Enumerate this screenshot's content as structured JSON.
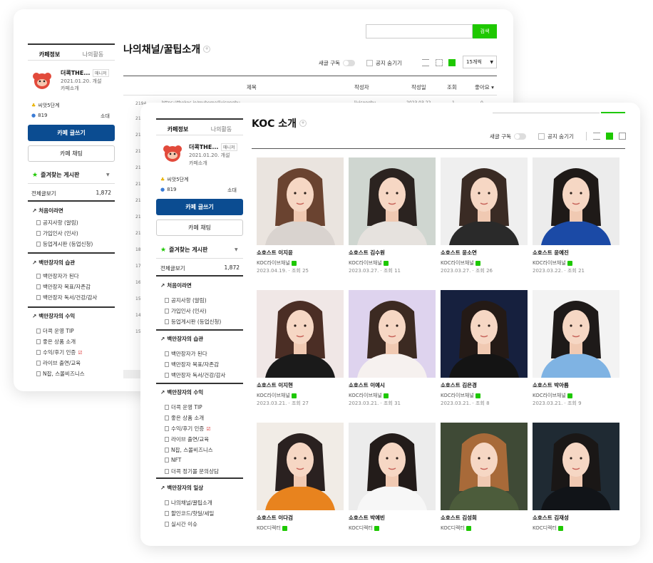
{
  "colors": {
    "accent_green": "#1ec800",
    "button_navy": "#0b4c91"
  },
  "back": {
    "search": {
      "value": "",
      "button": "검색"
    },
    "sidebar": {
      "tabs": [
        "카페정보",
        "나의활동"
      ],
      "profile": {
        "name": "더콕THE...",
        "role": "매니저",
        "date": "2021.01.20. 개설",
        "nickname": "카페소개"
      },
      "level": "씨앗5단계",
      "members": "819",
      "town": "소대",
      "write_button": "카페 글쓰기",
      "chat_button": "카페 채팅",
      "favorites_label": "즐겨찾는 게시판",
      "all_posts": {
        "label": "전체글보기",
        "count": "1,872"
      },
      "groups": [
        {
          "title": "처음이라면",
          "items": [
            "공지사항 (알림)",
            "가입인사 (인사)",
            "등업게시판 (등업신청)"
          ]
        },
        {
          "title": "백만장자의 습관",
          "items": [
            "백만장자가 된다",
            "백만장자 목표/자존감",
            "백만장자 독서/건강/감사"
          ]
        },
        {
          "title": "백만장자의 수익",
          "items": [
            "더콕 운영 TIP",
            "좋은 상품 소개",
            "수익/후기 인증",
            "라이브 출연/교육",
            "N잡, 스몰비즈니스"
          ]
        }
      ]
    },
    "board": {
      "title": "나의채널/꿀팁소개",
      "subscribe": "새글 구독",
      "hide_notice": "공지 숨기기",
      "per_page": "15개씩",
      "headers": {
        "title": "제목",
        "author": "작성자",
        "date": "작성일",
        "views": "조회",
        "likes": "좋아요"
      },
      "first_row": {
        "no": "2194",
        "title": "https://thekoc.io/myhome/livisonghu",
        "author": "livisonghu",
        "date": "2023.03.22.",
        "views": "1",
        "likes": "0"
      },
      "row_numbers": [
        "21",
        "21",
        "21",
        "21",
        "21",
        "21",
        "21",
        "21",
        "18",
        "17",
        "16",
        "15",
        "14",
        "15"
      ]
    }
  },
  "front": {
    "sidebar": {
      "tabs": [
        "카페정보",
        "나의활동"
      ],
      "profile": {
        "name": "더콕THE...",
        "role": "매니저",
        "date": "2021.01.20. 개설",
        "nickname": "카페소개"
      },
      "level": "씨앗5단계",
      "members": "819",
      "town": "소대",
      "write_button": "카페 글쓰기",
      "chat_button": "카페 채팅",
      "favorites_label": "즐겨찾는 게시판",
      "all_posts": {
        "label": "전체글보기",
        "count": "1,872"
      },
      "groups": [
        {
          "title": "처음이라면",
          "items": [
            "공지사항 (알림)",
            "가입인사 (인사)",
            "등업게시판 (등업신청)"
          ]
        },
        {
          "title": "백만장자의 습관",
          "items": [
            "백만장자가 된다",
            "백만장자 목표/자존감",
            "백만장자 독서/건강/감사"
          ]
        },
        {
          "title": "백만장자의 수익",
          "items": [
            "더콕 운영 TIP",
            "좋은 상품 소개",
            "수익/후기 인증",
            "라이브 출연/교육",
            "N잡, 스몰비즈니스",
            "NFT",
            "더콕 정기몰 문의상담"
          ]
        },
        {
          "title": "백만장자의 일상",
          "items": [
            "나의채널/꿀팁소개",
            "할인코드/핫딜/세일",
            "실시간 이슈"
          ]
        }
      ]
    },
    "board": {
      "title": "KOC 소개",
      "subscribe": "새글 구독",
      "hide_notice": "공지 숨기기"
    },
    "cards": [
      {
        "title": "쇼호스트 이지윤",
        "author": "KOC라이브채널",
        "date": "2023.04.19.",
        "views": "· 조회 25"
      },
      {
        "title": "쇼호스트 김수원",
        "author": "KOC라이브채널",
        "date": "2023.03.27.",
        "views": "· 조회 11"
      },
      {
        "title": "쇼호스트 윤소연",
        "author": "KOC라이브채널",
        "date": "2023.03.27.",
        "views": "· 조회 26"
      },
      {
        "title": "쇼호스트 윤예진",
        "author": "KOC라이브채널",
        "date": "2023.03.22.",
        "views": "· 조회 21"
      },
      {
        "title": "쇼호스트 이지현",
        "author": "KOC라이브채널",
        "date": "2023.03.21.",
        "views": "· 조회 27"
      },
      {
        "title": "쇼호스트 이예시",
        "author": "KOC라이브채널",
        "date": "2023.03.21.",
        "views": "· 조회 31"
      },
      {
        "title": "쇼호스트 김은경",
        "author": "KOC라이브채널",
        "date": "2023.03.21.",
        "views": "· 조회 8"
      },
      {
        "title": "쇼호스트 박아름",
        "author": "KOC라이브채널",
        "date": "2023.03.21.",
        "views": "· 조회 9"
      },
      {
        "title": "쇼호스트 이다검",
        "author": "KOC디렉터",
        "date": "",
        "views": ""
      },
      {
        "title": "쇼호스트 박예빈",
        "author": "KOC디렉터",
        "date": "",
        "views": ""
      },
      {
        "title": "쇼호스트 김성희",
        "author": "KOC디렉터",
        "date": "",
        "views": ""
      },
      {
        "title": "쇼호스트 김재성",
        "author": "KOC디렉터",
        "date": "",
        "views": ""
      }
    ],
    "thumb_colors": [
      {
        "bg": "#eae4df",
        "hair": "#6a4330",
        "top": "#d9d3cf"
      },
      {
        "bg": "#cfd6d0",
        "hair": "#2b2320",
        "top": "#e6e2de"
      },
      {
        "bg": "#efefef",
        "hair": "#3a2b24",
        "top": "#2a2a2a"
      },
      {
        "bg": "#ececec",
        "hair": "#1f1a18",
        "top": "#1b4aa6"
      },
      {
        "bg": "#f0e7e6",
        "hair": "#4b2e25",
        "top": "#1a1a1a"
      },
      {
        "bg": "#ded3ee",
        "hair": "#3c2a22",
        "top": "#f6f1ef"
      },
      {
        "bg": "#16203e",
        "hair": "#241a16",
        "top": "#141414"
      },
      {
        "bg": "#f3f3f3",
        "hair": "#1e1a19",
        "top": "#7fb3e3"
      },
      {
        "bg": "#f1ece6",
        "hair": "#2a2120",
        "top": "#e8831e"
      },
      {
        "bg": "#ececec",
        "hair": "#231c1a",
        "top": "#f7f7f7"
      },
      {
        "bg": "#3f4a36",
        "hair": "#a86a39",
        "top": "#4c5c3b"
      },
      {
        "bg": "#1f2a33",
        "hair": "#1a1716",
        "top": "#111418"
      }
    ]
  }
}
